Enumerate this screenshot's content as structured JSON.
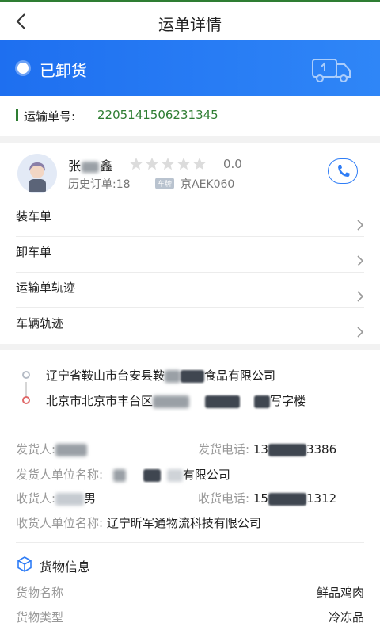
{
  "nav": {
    "title": "运单详情",
    "back_icon": "chevron-left-icon"
  },
  "status": {
    "text": "已卸货",
    "icon": "truck-icon"
  },
  "waybill": {
    "label": "运输单号:",
    "number": "2205141506231345"
  },
  "driver": {
    "name_visible_first": "张",
    "name_visible_last": "鑫",
    "rating": "0.0",
    "stars_filled": 0,
    "stars_total": 5,
    "history": "历史订单:18",
    "plate_tag": "车牌",
    "plate": "京AEK060",
    "phone_icon": "phone-icon"
  },
  "menu": [
    {
      "label": "装车单"
    },
    {
      "label": "卸车单"
    },
    {
      "label": "运输单轨迹"
    },
    {
      "label": "车辆轨迹"
    }
  ],
  "route": {
    "origin_prefix": "辽宁省鞍山市台安县鞍",
    "origin_suffix": "食品有限公司",
    "destination_prefix": "北京市北京市丰台区",
    "destination_suffix": "写字楼"
  },
  "shipper": {
    "sender_label": "发货人:",
    "sender_phone_label": "发货电话:",
    "sender_phone_prefix": "13",
    "sender_phone_suffix": "3386",
    "sender_company_label": "发货人单位名称:",
    "sender_company_suffix": "有限公司",
    "receiver_label": "收货人:",
    "receiver_name_suffix": "男",
    "receiver_phone_label": "收货电话:",
    "receiver_phone_prefix": "15",
    "receiver_phone_suffix": "1312",
    "receiver_company_label": "收货人单位名称:",
    "receiver_company": "辽宁昕军通物流科技有限公司"
  },
  "cargo": {
    "title": "货物信息",
    "name_label": "货物名称",
    "name_value": "鲜品鸡肉",
    "type_label": "货物类型",
    "type_value": "冷冻品"
  },
  "colors": {
    "accent": "#2f7df6",
    "green": "#2e7d32",
    "banner": "#1e6ff0"
  }
}
